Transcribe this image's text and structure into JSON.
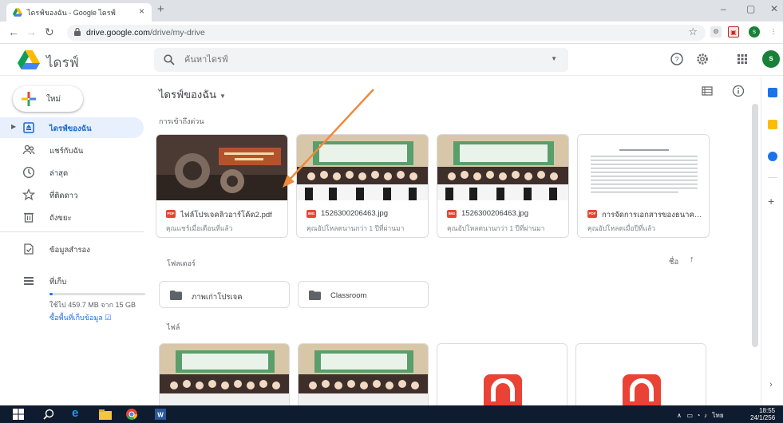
{
  "browser": {
    "tab_title": "ไดรฟ์ของฉัน - Google ไดรฟ์",
    "tab_close": "×",
    "new_tab": "+",
    "url_host": "drive.google.com",
    "url_path": "/drive/my-drive",
    "profile_initial": "s",
    "window_controls": {
      "minimize": "–",
      "restore": "▢",
      "close": "✕"
    }
  },
  "header": {
    "app_name": "ไดรฟ์",
    "search_placeholder": "ค้นหาไดรฟ์",
    "avatar_initial": "s"
  },
  "sidebar": {
    "new_label": "ใหม่",
    "items": [
      {
        "label": "ไดรฟ์ของฉัน",
        "icon": "drive-icon",
        "active": true
      },
      {
        "label": "แชร์กับฉัน",
        "icon": "shared-icon"
      },
      {
        "label": "ล่าสุด",
        "icon": "clock-icon"
      },
      {
        "label": "ที่ติดดาว",
        "icon": "star-icon"
      },
      {
        "label": "ถังขยะ",
        "icon": "trash-icon"
      },
      {
        "label": "ข้อมูลสำรอง",
        "icon": "backup-icon"
      },
      {
        "label": "ที่เก็บ",
        "icon": "storage-icon"
      }
    ],
    "storage": {
      "used_text": "ใช้ไป 459.7 MB จาก 15 GB",
      "used_fraction": 0.03,
      "buy_label": "ซื้อพื้นที่เก็บข้อมูล ☑"
    }
  },
  "main": {
    "title": "ไดรฟ์ของฉัน",
    "quick_access_label": "การเข้าถึงด่วน",
    "quick_access": [
      {
        "name": "ไฟล์โปรเจคลิวอาร์โค้ด2.pdf",
        "sub": "คุณแชร์เมื่อเดือนที่แล้ว",
        "type": "PDF",
        "type_color": "#ea4335",
        "thumb": "projector"
      },
      {
        "name": "1526300206463.jpg",
        "sub": "คุณอัปโหลดนานกว่า 1 ปีที่ผ่านมา",
        "type": "IMG",
        "type_color": "#ea4335",
        "thumb": "group"
      },
      {
        "name": "1526300206463.jpg",
        "sub": "คุณอัปโหลดนานกว่า 1 ปีที่ผ่านมา",
        "type": "IMG",
        "type_color": "#ea4335",
        "thumb": "group"
      },
      {
        "name": "การจัดการเอกสารของธนาคาร...",
        "sub": "คุณอัปโหลดเมื่อปีที่แล้ว",
        "type": "PDF",
        "type_color": "#ea4335",
        "thumb": "doc"
      }
    ],
    "folders_label": "โฟลเดอร์",
    "sort_label": "ชื่อ",
    "sort_arrow": "↑",
    "folders": [
      {
        "name": "ภาพเก่าโปรเจค"
      },
      {
        "name": "Classroom"
      }
    ],
    "files_label": "ไฟล์",
    "files": [
      {
        "thumb": "group"
      },
      {
        "thumb": "group"
      },
      {
        "thumb": "pdf-red"
      },
      {
        "thumb": "pdf-red"
      }
    ]
  },
  "taskbar": {
    "lang": "ไทย",
    "time": "18:55",
    "date": "24/1/256"
  },
  "colors": {
    "accent": "#1a73e8",
    "active_bg": "#e8f0fe",
    "annotation_arrow": "#f08a3c",
    "pdf_red": "#ea4335"
  }
}
